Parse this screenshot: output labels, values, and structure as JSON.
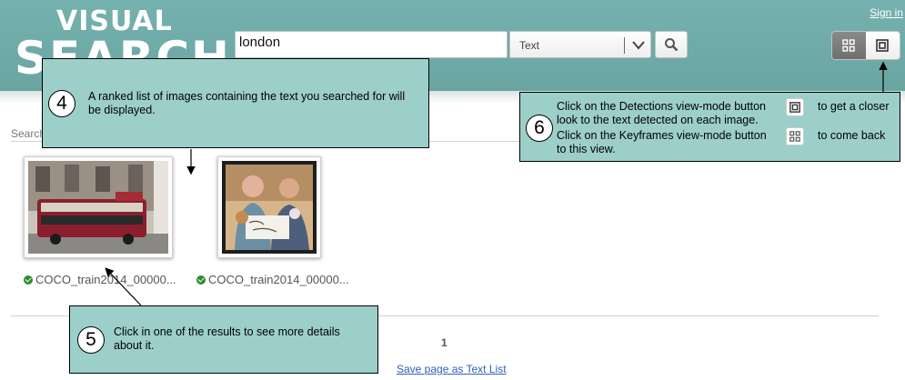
{
  "header": {
    "logo_line1": "VISUAL",
    "logo_line2": "SEARCH",
    "signin": "Sign in",
    "search_value": "london",
    "type_selected": "Text",
    "icons": {
      "search": "magnifier-icon",
      "dropdown": "chevron-down-icon",
      "keyframes": "grid-icon",
      "detections": "square-frame-icon"
    }
  },
  "results": {
    "search_label": "Search",
    "items": [
      {
        "caption": "COCO_train2014_00000...",
        "image": "red double-decker bus on a london street"
      },
      {
        "caption": "COCO_train2014_00000...",
        "image": "two men holding a handwritten sign and toys"
      }
    ],
    "page_number": "1",
    "save_link": "Save page as Text List"
  },
  "callouts": {
    "c4": {
      "num": "4",
      "text": "A ranked list of images containing the text you searched for will be displayed."
    },
    "c5": {
      "num": "5",
      "text": "Click in one of the results to see more details about it."
    },
    "c6": {
      "num": "6",
      "line1a": "Click on the Detections view-mode button",
      "line1b": "to get a closer",
      "line2": "look to the text detected on each image.",
      "line3a": "Click on the Keyframes view-mode button",
      "line3b": "to come back",
      "line4": "to this view."
    }
  },
  "colors": {
    "header": "#6fa9a6",
    "callout": "#9ccfca",
    "link": "#2f5fb8",
    "check": "#2e8b2e"
  }
}
